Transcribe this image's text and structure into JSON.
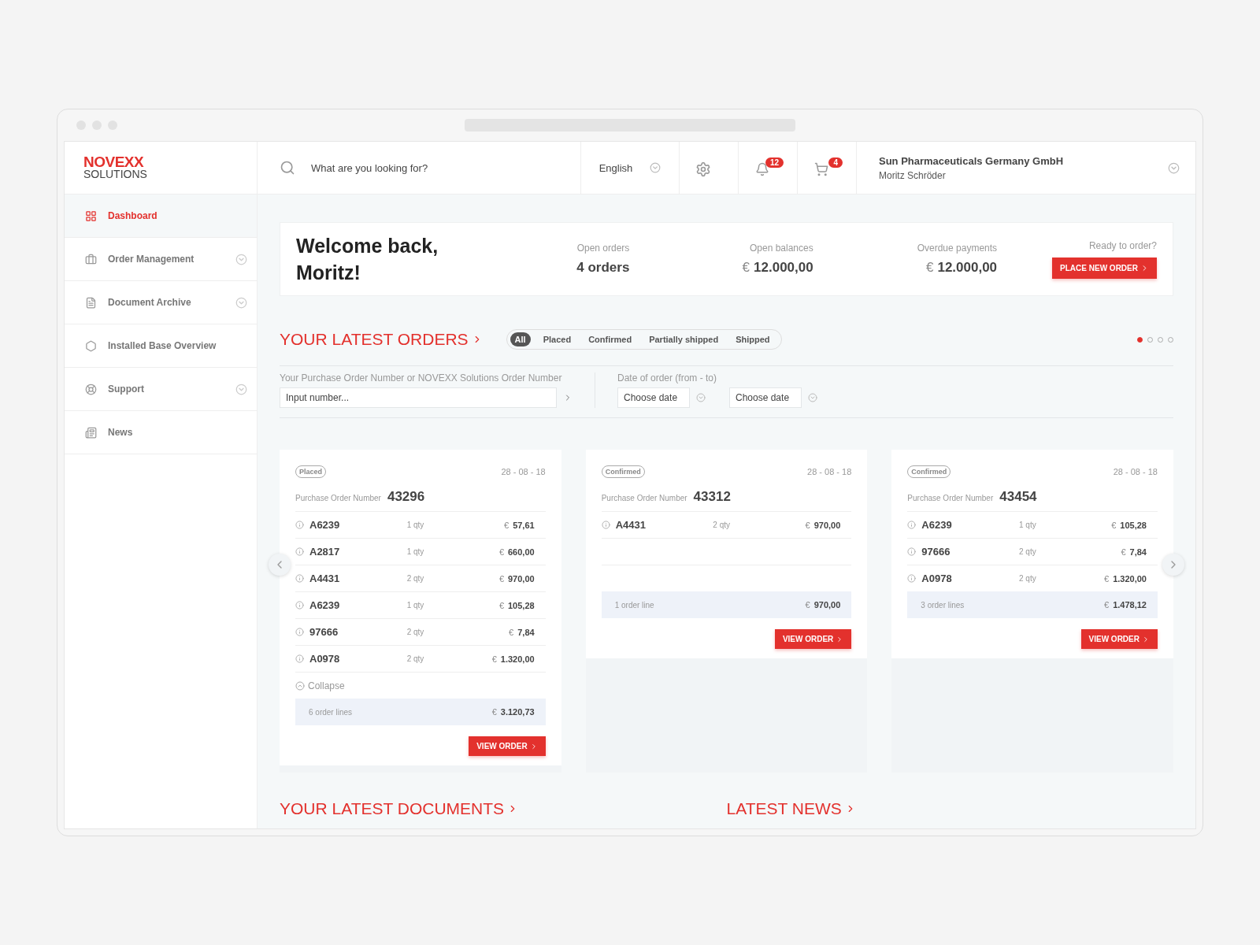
{
  "logo": {
    "brand": "NOVEXX",
    "sub": "SOLUTIONS"
  },
  "search": {
    "placeholder": "What are you looking for?"
  },
  "language": "English",
  "notifications": {
    "count": "12"
  },
  "cart": {
    "count": "4"
  },
  "account": {
    "company": "Sun Pharmaceuticals Germany GmbH",
    "user": "Moritz Schröder"
  },
  "sidebar": {
    "items": [
      {
        "label": "Dashboard",
        "kind": "grid",
        "selected": true,
        "expandable": false
      },
      {
        "label": "Order Management",
        "kind": "briefcase",
        "selected": false,
        "expandable": true
      },
      {
        "label": "Document Archive",
        "kind": "file",
        "selected": false,
        "expandable": true
      },
      {
        "label": "Installed Base Overview",
        "kind": "hexagon",
        "selected": false,
        "expandable": false
      },
      {
        "label": "Support",
        "kind": "lifebuoy",
        "selected": false,
        "expandable": true
      },
      {
        "label": "News",
        "kind": "newspaper",
        "selected": false,
        "expandable": false
      }
    ]
  },
  "welcome": {
    "title": "Welcome back, Moritz!",
    "stats": [
      {
        "label": "Open orders",
        "value": "4 orders"
      },
      {
        "label": "Open balances",
        "currency": "€",
        "value": "12.000,00"
      },
      {
        "label": "Overdue payments",
        "currency": "€",
        "value": "12.000,00"
      }
    ],
    "prompt": "Ready to order?",
    "button": "PLACE NEW ORDER"
  },
  "orders": {
    "title": "YOUR LATEST ORDERS",
    "filters": [
      {
        "label": "All",
        "selected": true
      },
      {
        "label": "Placed",
        "selected": false
      },
      {
        "label": "Confirmed",
        "selected": false
      },
      {
        "label": "Partially shipped",
        "selected": false
      },
      {
        "label": "Shipped",
        "selected": false
      }
    ],
    "pages": [
      {
        "selected": true
      },
      {
        "selected": false
      },
      {
        "selected": false
      },
      {
        "selected": false
      }
    ],
    "number_filter": {
      "label": "Your Purchase Order Number or NOVEXX Solutions Order Number",
      "placeholder": "Input number..."
    },
    "date_filter": {
      "label": "Date of order (from - to)",
      "from_placeholder": "Choose date",
      "to_placeholder": "Choose date"
    },
    "cards": [
      {
        "status": "Placed",
        "date": "28 - 08 - 18",
        "po_label": "Purchase Order Number",
        "po_number": "43296",
        "lines": [
          {
            "item": "A6239",
            "qty": "1 qty",
            "currency": "€",
            "price": "57,61"
          },
          {
            "item": "A2817",
            "qty": "1 qty",
            "currency": "€",
            "price": "660,00"
          },
          {
            "item": "A4431",
            "qty": "2 qty",
            "currency": "€",
            "price": "970,00"
          },
          {
            "item": "A6239",
            "qty": "1 qty",
            "currency": "€",
            "price": "105,28"
          },
          {
            "item": "97666",
            "qty": "2 qty",
            "currency": "€",
            "price": "7,84"
          },
          {
            "item": "A0978",
            "qty": "2 qty",
            "currency": "€",
            "price": "1.320,00"
          }
        ],
        "collapse": "Collapse",
        "summary": "6 order lines",
        "total_currency": "€",
        "total": "3.120,73",
        "button": "VIEW ORDER"
      },
      {
        "status": "Confirmed",
        "date": "28 - 08 - 18",
        "po_label": "Purchase Order Number",
        "po_number": "43312",
        "lines": [
          {
            "item": "A4431",
            "qty": "2 qty",
            "currency": "€",
            "price": "970,00"
          }
        ],
        "summary": "1 order line",
        "total_currency": "€",
        "total": "970,00",
        "button": "VIEW ORDER"
      },
      {
        "status": "Confirmed",
        "date": "28 - 08 - 18",
        "po_label": "Purchase Order Number",
        "po_number": "43454",
        "lines": [
          {
            "item": "A6239",
            "qty": "1 qty",
            "currency": "€",
            "price": "105,28"
          },
          {
            "item": "97666",
            "qty": "2 qty",
            "currency": "€",
            "price": "7,84"
          },
          {
            "item": "A0978",
            "qty": "2 qty",
            "currency": "€",
            "price": "1.320,00"
          }
        ],
        "summary": "3 order lines",
        "total_currency": "€",
        "total": "1.478,12",
        "button": "VIEW ORDER"
      }
    ]
  },
  "sections": [
    {
      "title": "YOUR LATEST DOCUMENTS"
    },
    {
      "title": "LATEST NEWS"
    }
  ]
}
